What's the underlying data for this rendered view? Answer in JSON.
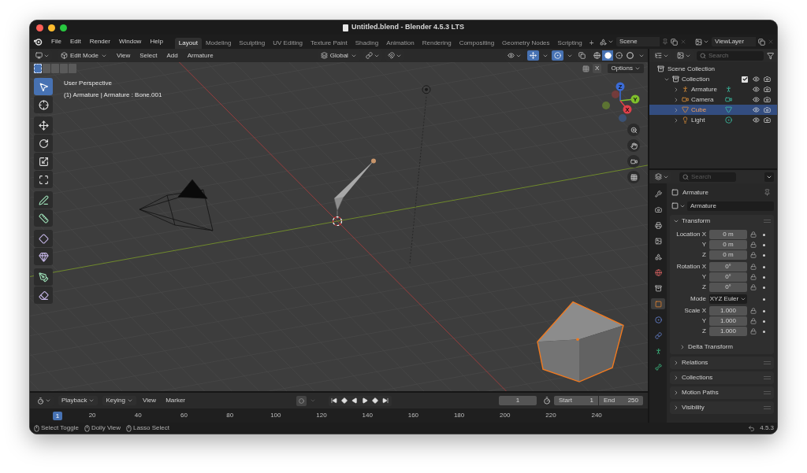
{
  "window": {
    "title": "Untitled.blend - Blender 4.5.3 LTS"
  },
  "menu": [
    "File",
    "Edit",
    "Render",
    "Window",
    "Help"
  ],
  "workspaces": [
    {
      "label": "Layout",
      "selected": true
    },
    {
      "label": "Modeling",
      "selected": false
    },
    {
      "label": "Sculpting",
      "selected": false
    },
    {
      "label": "UV Editing",
      "selected": false
    },
    {
      "label": "Texture Paint",
      "selected": false
    },
    {
      "label": "Shading",
      "selected": false
    },
    {
      "label": "Animation",
      "selected": false
    },
    {
      "label": "Rendering",
      "selected": false
    },
    {
      "label": "Compositing",
      "selected": false
    },
    {
      "label": "Geometry Nodes",
      "selected": false
    },
    {
      "label": "Scripting",
      "selected": false
    }
  ],
  "add_workspace": "+",
  "scene": "Scene",
  "view_layer": "ViewLayer",
  "viewport": {
    "mode": "Edit Mode",
    "menus": [
      "View",
      "Select",
      "Add",
      "Armature"
    ],
    "orientation": "Global",
    "shading": [
      {
        "kind": "wireframe",
        "selected": false
      },
      {
        "kind": "solid",
        "selected": true
      },
      {
        "kind": "material",
        "selected": false
      },
      {
        "kind": "rendered",
        "selected": false
      }
    ],
    "select_modes": [
      {
        "selected": true
      },
      {
        "selected": false
      },
      {
        "selected": false
      },
      {
        "selected": false
      },
      {
        "selected": false
      }
    ],
    "axis_toggle": "X",
    "options": "Options",
    "info": [
      "User Perspective",
      "(1) Armature | Armature : Bone.001"
    ],
    "tool_groups": [
      [
        {
          "kind": "select_box",
          "selected": true
        },
        {
          "kind": "cursor",
          "selected": false
        }
      ],
      [
        {
          "kind": "move",
          "selected": false
        },
        {
          "kind": "rotate",
          "selected": false
        },
        {
          "kind": "scale",
          "selected": false
        },
        {
          "kind": "transform",
          "selected": false
        }
      ],
      [
        {
          "kind": "annotate",
          "selected": false
        },
        {
          "kind": "measure",
          "selected": false
        }
      ],
      [
        {
          "kind": "roll",
          "selected": false
        },
        {
          "kind": "bone_size",
          "selected": false
        }
      ],
      [
        {
          "kind": "extrude",
          "selected": false
        },
        {
          "kind": "envelope",
          "selected": false
        }
      ]
    ],
    "gizmo_axes": [
      "X",
      "Y",
      "Z"
    ]
  },
  "timeline": {
    "menus": [
      {
        "label": "Playback",
        "dropdown": true
      },
      {
        "label": "Keying",
        "dropdown": true
      },
      {
        "label": "View",
        "dropdown": false
      },
      {
        "label": "Marker",
        "dropdown": false
      }
    ],
    "current_frame": "1",
    "start_label": "Start",
    "start": "1",
    "end_label": "End",
    "end": "250",
    "ruler": [
      {
        "label": "1",
        "selected": true
      },
      {
        "label": "20",
        "selected": false
      },
      {
        "label": "40",
        "selected": false
      },
      {
        "label": "60",
        "selected": false
      },
      {
        "label": "80",
        "selected": false
      },
      {
        "label": "100",
        "selected": false
      },
      {
        "label": "120",
        "selected": false
      },
      {
        "label": "140",
        "selected": false
      },
      {
        "label": "160",
        "selected": false
      },
      {
        "label": "180",
        "selected": false
      },
      {
        "label": "200",
        "selected": false
      },
      {
        "label": "220",
        "selected": false
      },
      {
        "label": "240",
        "selected": false
      }
    ]
  },
  "outliner": {
    "placeholder": "Search",
    "root": "Scene Collection",
    "collection": {
      "label": "Collection",
      "expanded": true,
      "checked": true,
      "children": [
        {
          "label": "Armature",
          "kind": "armature",
          "selected": false
        },
        {
          "label": "Camera",
          "kind": "camera",
          "selected": false
        },
        {
          "label": "Cube",
          "kind": "mesh",
          "selected": true
        },
        {
          "label": "Light",
          "kind": "light",
          "selected": false
        }
      ]
    }
  },
  "properties": {
    "placeholder": "Search",
    "tabs": [
      {
        "kind": "tool",
        "selected": false
      },
      {
        "kind": "render",
        "selected": false
      },
      {
        "kind": "output",
        "selected": false
      },
      {
        "kind": "view_layer",
        "selected": false
      },
      {
        "kind": "scene",
        "selected": false
      },
      {
        "kind": "world",
        "selected": false
      },
      {
        "kind": "collection",
        "selected": false
      },
      {
        "kind": "object",
        "selected": true
      },
      {
        "kind": "physics",
        "selected": false
      },
      {
        "kind": "constraints",
        "selected": false
      },
      {
        "kind": "data",
        "selected": false
      },
      {
        "kind": "bone",
        "selected": false
      }
    ],
    "object": "Armature",
    "data_name": "Armature",
    "transform": {
      "title": "Transform",
      "expanded": true,
      "groups": [
        {
          "rows": [
            {
              "label": "Location X",
              "value": "0 m",
              "kind": "field"
            },
            {
              "label": "Y",
              "value": "0 m",
              "kind": "field"
            },
            {
              "label": "Z",
              "value": "0 m",
              "kind": "field"
            }
          ]
        },
        {
          "rows": [
            {
              "label": "Rotation X",
              "value": "0°",
              "kind": "field"
            },
            {
              "label": "Y",
              "value": "0°",
              "kind": "field"
            },
            {
              "label": "Z",
              "value": "0°",
              "kind": "field"
            }
          ]
        },
        {
          "rows": [
            {
              "label": "Mode",
              "value": "XYZ Euler",
              "kind": "dropdown"
            }
          ]
        },
        {
          "rows": [
            {
              "label": "Scale X",
              "value": "1.000",
              "kind": "field"
            },
            {
              "label": "Y",
              "value": "1.000",
              "kind": "field"
            },
            {
              "label": "Z",
              "value": "1.000",
              "kind": "field"
            }
          ]
        }
      ],
      "subpanel": {
        "title": "Delta Transform",
        "expanded": false
      }
    },
    "panels": [
      {
        "title": "Relations",
        "expanded": false
      },
      {
        "title": "Collections",
        "expanded": false
      },
      {
        "title": "Motion Paths",
        "expanded": false
      },
      {
        "title": "Visibility",
        "expanded": false
      }
    ]
  },
  "status_bar": {
    "hints": [
      "Select Toggle",
      "Dolly View",
      "Lasso Select"
    ],
    "version": "4.5.3"
  }
}
